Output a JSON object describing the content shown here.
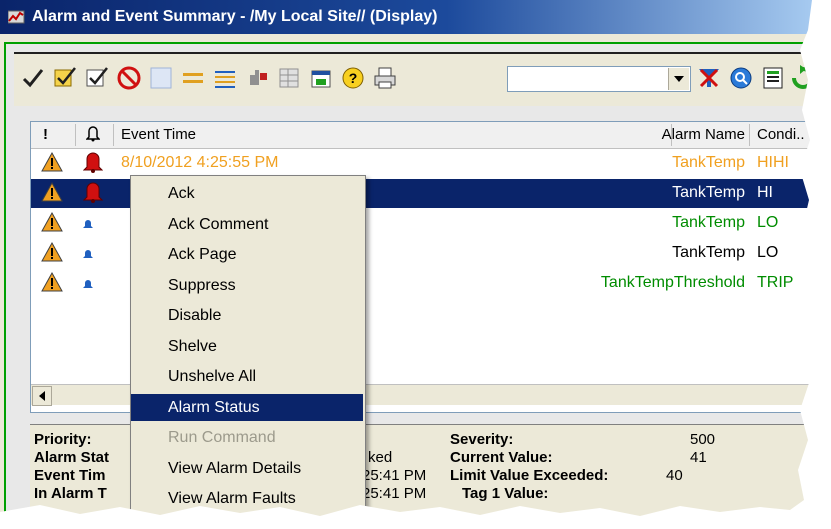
{
  "window": {
    "title": "Alarm and Event Summary - /My Local Site// (Display)"
  },
  "toolbar": {
    "buttons": [
      {
        "name": "ack-all-checkmark-icon"
      },
      {
        "name": "ack-visible-icon"
      },
      {
        "name": "ack-selected-icon"
      },
      {
        "name": "suppress-prohibit-icon"
      },
      {
        "name": "blank-icon"
      },
      {
        "name": "equal-lines-icon"
      },
      {
        "name": "sort-lines-icon"
      },
      {
        "name": "configure-alarm-icon"
      },
      {
        "name": "table-grid-icon"
      },
      {
        "name": "properties-icon"
      },
      {
        "name": "help-icon"
      },
      {
        "name": "print-icon"
      },
      {
        "name": "clear-filter-icon"
      },
      {
        "name": "search-icon"
      },
      {
        "name": "details-pane-icon"
      },
      {
        "name": "refresh-icon"
      }
    ],
    "filter_value": ""
  },
  "grid": {
    "columns": {
      "priority": "!",
      "bell": "",
      "event_time": "Event Time",
      "alarm_name": "Alarm Name",
      "condition": "Condi.."
    },
    "rows": [
      {
        "event_time": "8/10/2012 4:25:55 PM",
        "alarm_name": "TankTemp",
        "condition": "HIHI",
        "color": "#f0a020",
        "bell": "red"
      },
      {
        "event_time": "",
        "alarm_name": "TankTemp",
        "condition": "HI",
        "color": "#ffffff",
        "bell": "red",
        "selected": true
      },
      {
        "event_time": "",
        "alarm_name": "TankTemp",
        "condition": "LO",
        "color": "#008c00",
        "bell": "blue"
      },
      {
        "event_time": "",
        "alarm_name": "TankTemp",
        "condition": "LO",
        "color": "#000000",
        "bell": "blue"
      },
      {
        "event_time": "",
        "alarm_name": "TankTempThreshold",
        "condition": "TRIP",
        "color": "#008c00",
        "bell": "blue"
      }
    ]
  },
  "context_menu": {
    "items": [
      {
        "label": "Ack",
        "state": "normal"
      },
      {
        "label": "Ack Comment",
        "state": "normal"
      },
      {
        "label": "Ack Page",
        "state": "normal"
      },
      {
        "label": "Suppress",
        "state": "normal"
      },
      {
        "label": "Disable",
        "state": "normal"
      },
      {
        "label": "Shelve",
        "state": "normal"
      },
      {
        "label": "Unshelve All",
        "state": "normal"
      },
      {
        "label": "Alarm Status",
        "state": "highlighted"
      },
      {
        "label": "Run Command",
        "state": "disabled"
      },
      {
        "label": "View Alarm Details",
        "state": "normal"
      },
      {
        "label": "View Alarm Faults",
        "state": "normal"
      }
    ]
  },
  "details": {
    "priority_label": "Priority:",
    "alarm_state_label": "Alarm Stat",
    "alarm_state_value_fragment": "ked",
    "event_time_label": "Event Tim",
    "event_time_value_fragment": "25:41 PM",
    "in_alarm_label": "In Alarm T",
    "in_alarm_value_fragment": "25:41 PM",
    "severity_label": "Severity:",
    "severity_value": "500",
    "current_value_label": "Current Value:",
    "current_value": "41",
    "limit_value_label": "Limit Value Exceeded:",
    "limit_value": "40",
    "tag1_label": "Tag 1 Value:"
  }
}
